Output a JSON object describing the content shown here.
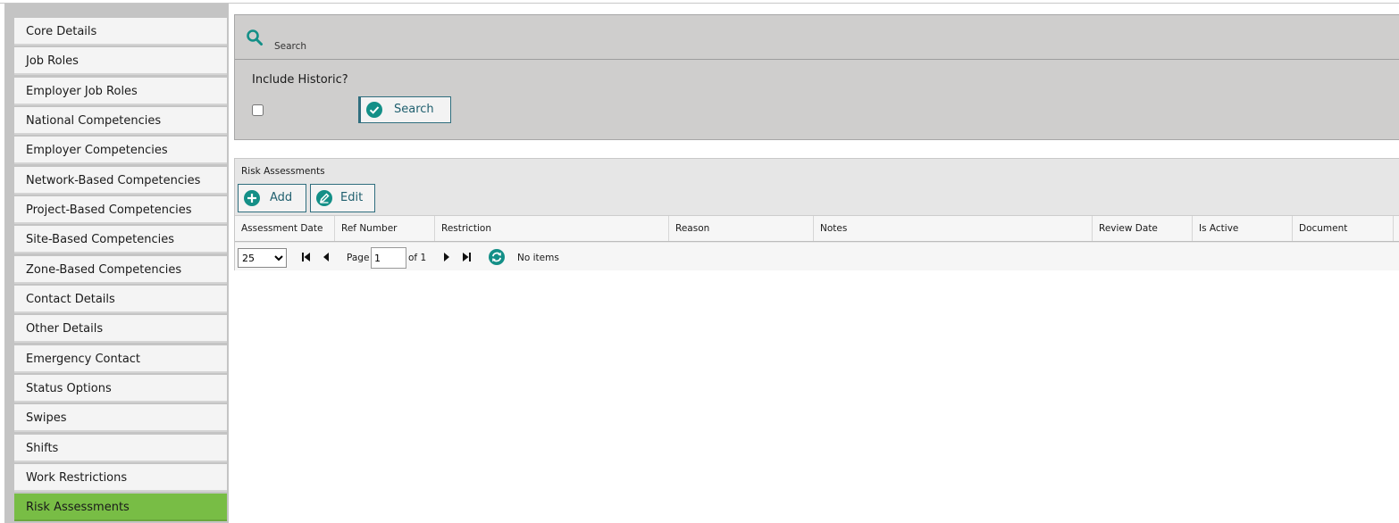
{
  "sidebar": {
    "items": [
      {
        "label": "Core Details"
      },
      {
        "label": "Job Roles"
      },
      {
        "label": "Employer Job Roles"
      },
      {
        "label": "National Competencies"
      },
      {
        "label": "Employer Competencies"
      },
      {
        "label": "Network-Based Competencies"
      },
      {
        "label": "Project-Based Competencies"
      },
      {
        "label": "Site-Based Competencies"
      },
      {
        "label": "Zone-Based Competencies"
      },
      {
        "label": "Contact Details"
      },
      {
        "label": "Other Details"
      },
      {
        "label": "Emergency Contact"
      },
      {
        "label": "Status Options"
      },
      {
        "label": "Swipes"
      },
      {
        "label": "Shifts"
      },
      {
        "label": "Work Restrictions"
      },
      {
        "label": "Risk Assessments"
      }
    ],
    "active": "Risk Assessments"
  },
  "search": {
    "title": "Search",
    "include_historic_label": "Include Historic?",
    "include_historic_checked": false,
    "button_label": "Search"
  },
  "grid": {
    "title": "Risk Assessments",
    "add_label": "Add",
    "edit_label": "Edit",
    "columns": [
      "Assessment Date",
      "Ref Number",
      "Restriction",
      "Reason",
      "Notes",
      "Review Date",
      "Is Active",
      "Document"
    ],
    "pager": {
      "page_size": "25",
      "page_label": "Page",
      "page_value": "1",
      "of_label": "of 1",
      "status": "No items"
    }
  },
  "colors": {
    "accent_teal": "#138f87",
    "active_green": "#78bd45",
    "button_border": "#2f6e7e"
  }
}
